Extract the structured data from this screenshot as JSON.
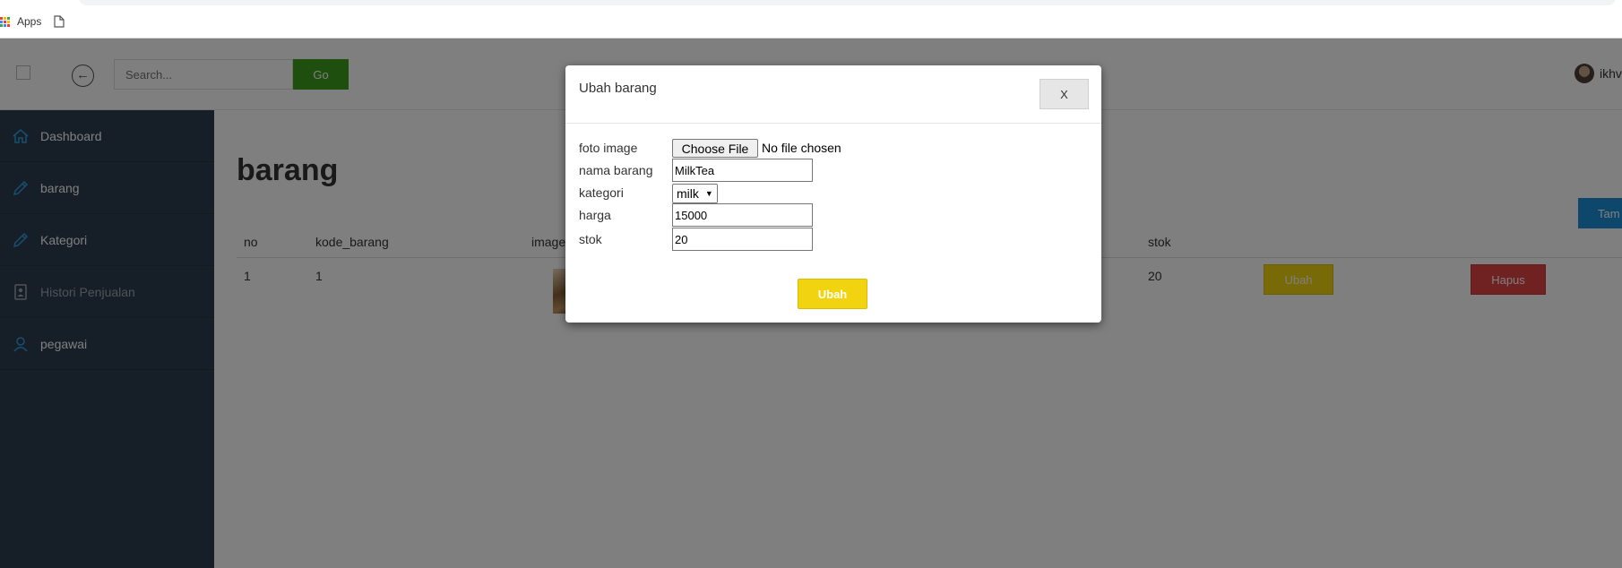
{
  "browser": {
    "bookmarks": [
      {
        "label": "Apps"
      }
    ]
  },
  "topbar": {
    "search_placeholder": "Search...",
    "go_label": "Go",
    "user_name": "ikhv"
  },
  "sidebar": {
    "items": [
      {
        "label": "Dashboard",
        "icon": "home-icon"
      },
      {
        "label": "barang",
        "icon": "pencil-icon"
      },
      {
        "label": "Kategori",
        "icon": "pencil-icon"
      },
      {
        "label": "Histori Penjualan",
        "icon": "badge-icon"
      },
      {
        "label": "pegawai",
        "icon": "user-icon"
      }
    ]
  },
  "page": {
    "title": "barang",
    "add_button": "Tam"
  },
  "table": {
    "headers": [
      "no",
      "kode_barang",
      "image",
      "stok"
    ],
    "rows": [
      {
        "no": "1",
        "kode_barang": "1",
        "stok": "20",
        "edit_label": "Ubah",
        "delete_label": "Hapus"
      }
    ]
  },
  "modal": {
    "title": "Ubah barang",
    "close_label": "X",
    "fields": {
      "foto_label": "foto image",
      "choose_file": "Choose File",
      "no_file": "No file chosen",
      "nama_label": "nama barang",
      "nama_value": "MilkTea",
      "kategori_label": "kategori",
      "kategori_value": "milk",
      "harga_label": "harga",
      "harga_value": "15000",
      "stok_label": "stok",
      "stok_value": "20"
    },
    "submit_label": "Ubah"
  },
  "colors": {
    "sidebar_bg": "#2d3e4f",
    "go_green": "#3f9e1e",
    "ubah_yellow": "#f1d40f",
    "hapus_red": "#e04444",
    "tambah_blue": "#1b8fd9"
  }
}
